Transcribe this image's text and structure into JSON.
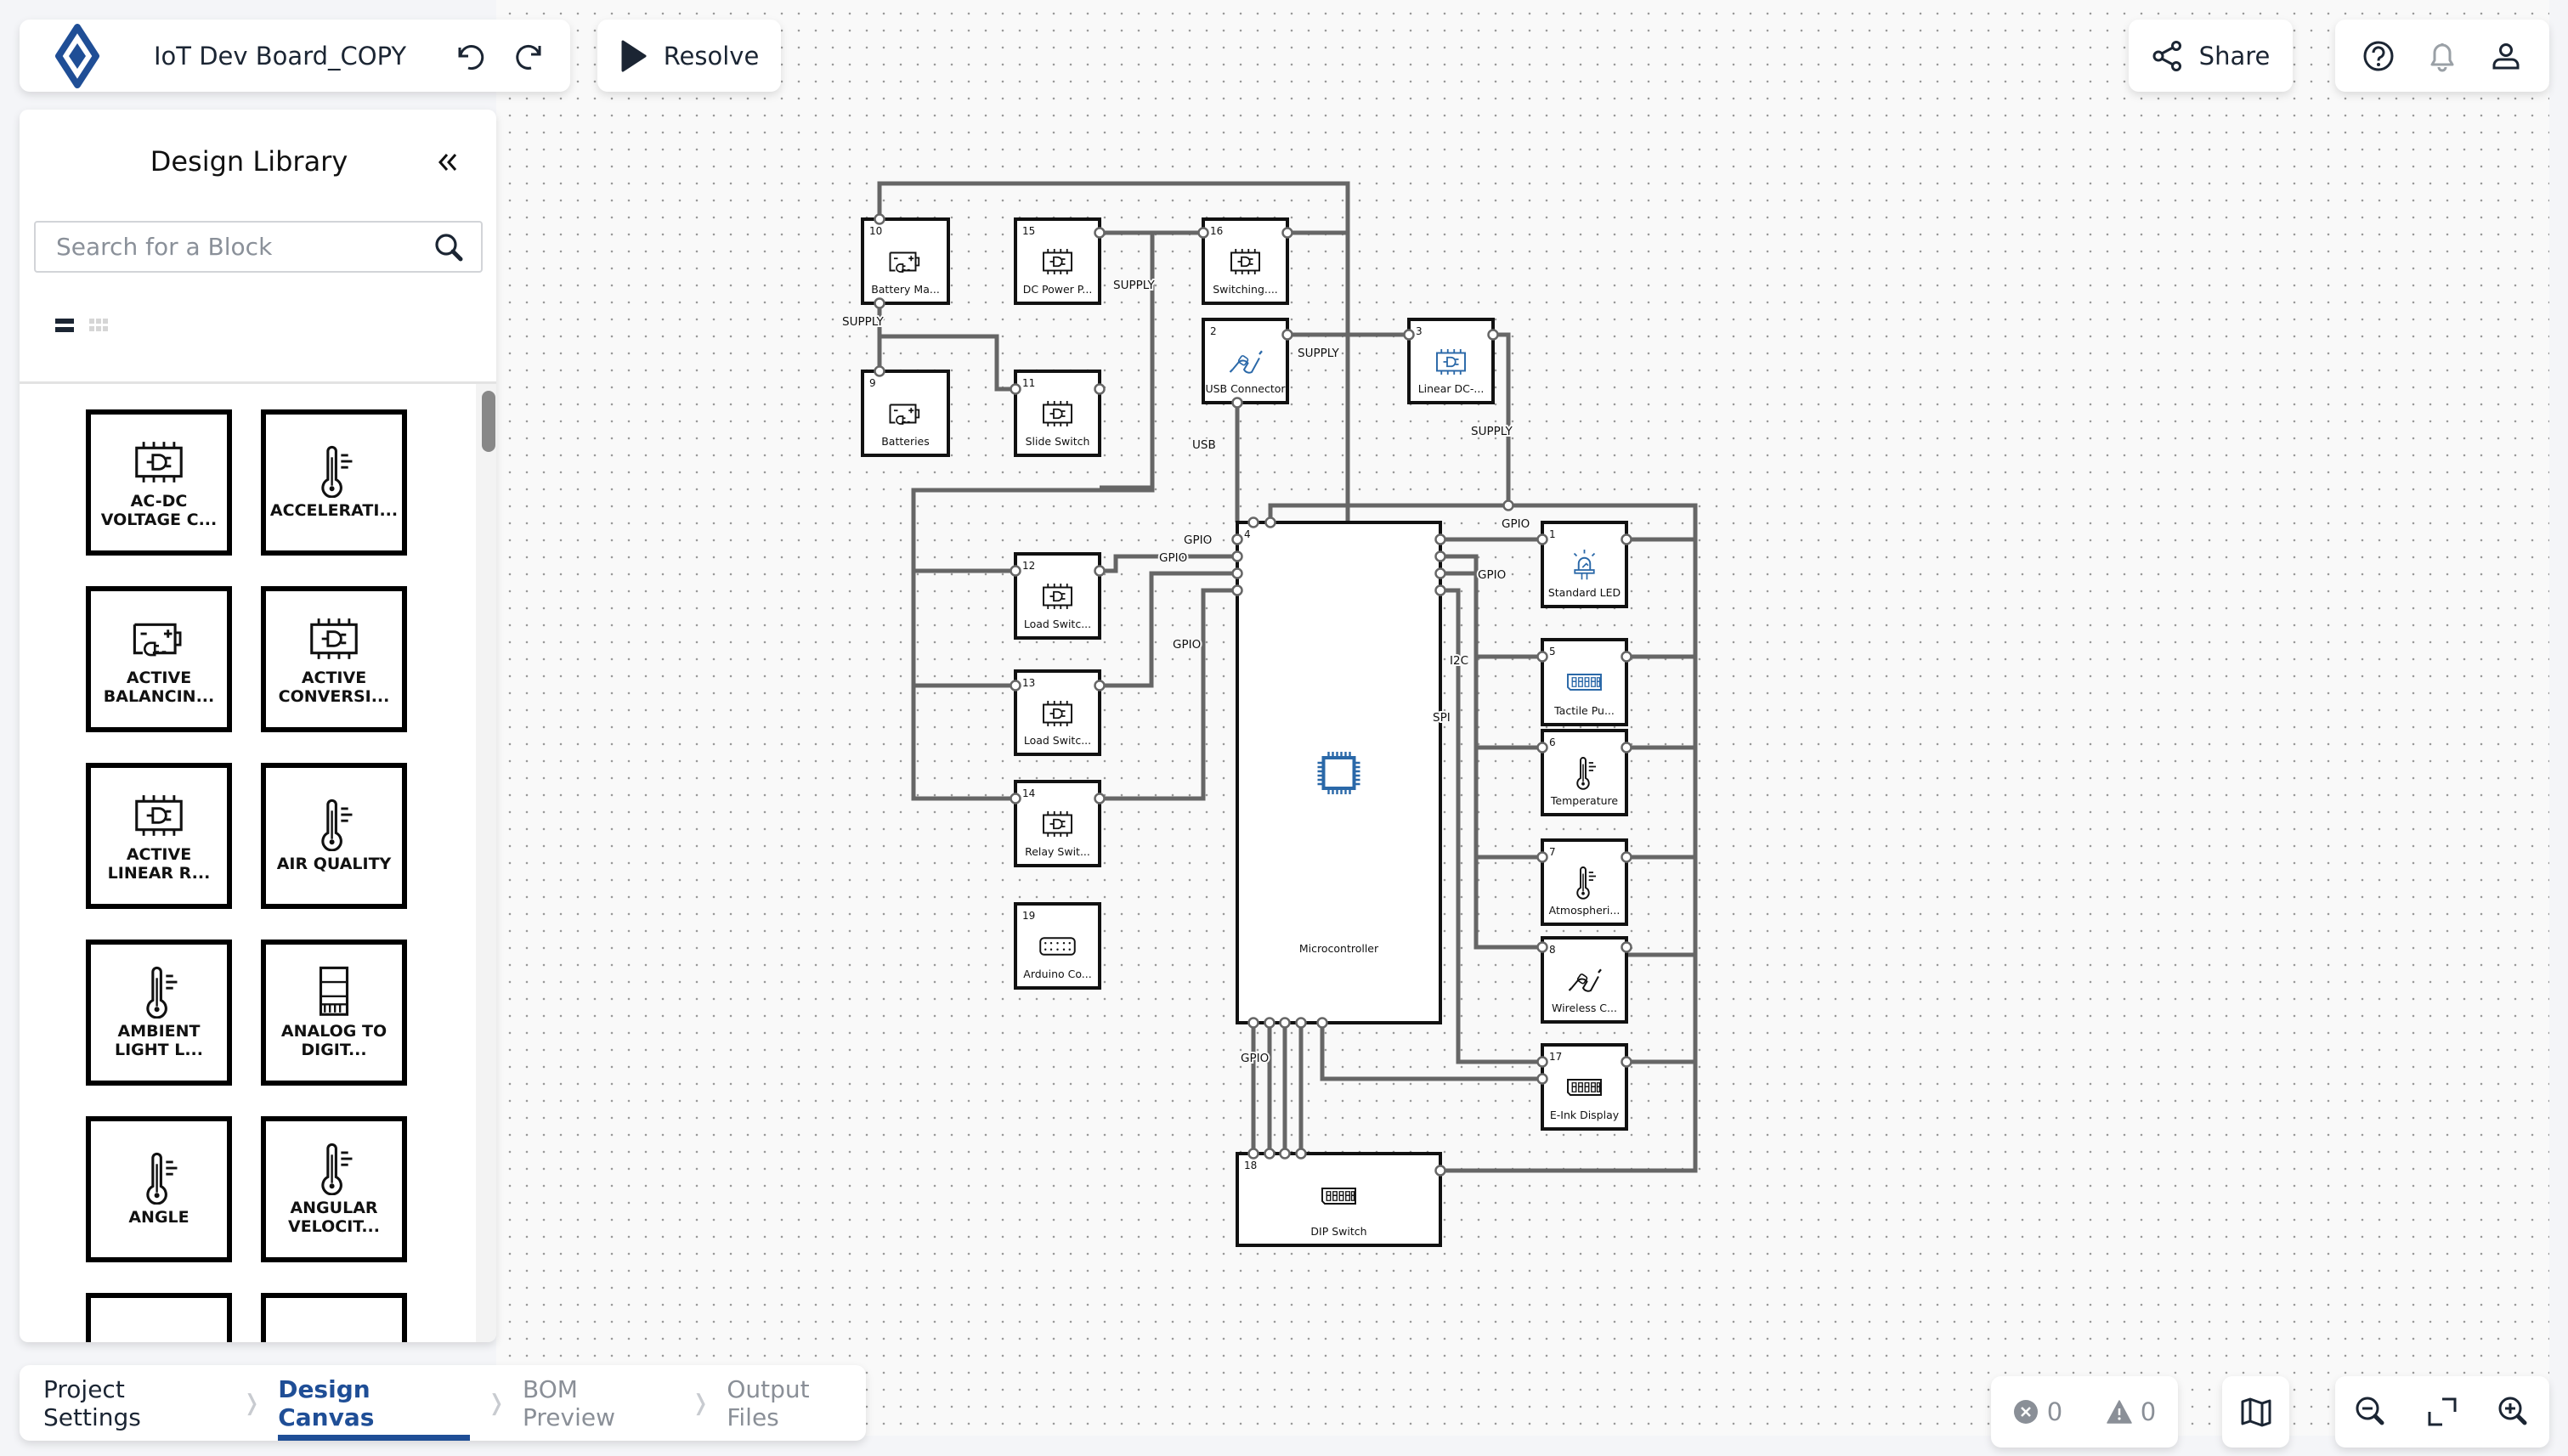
{
  "header": {
    "project_title": "IoT Dev Board_COPY",
    "undo_icon": "undo-icon",
    "redo_icon": "redo-icon",
    "resolve_label": "Resolve",
    "share_label": "Share",
    "help_icon": "help-circle-icon",
    "notifications_icon": "bell-icon",
    "account_icon": "user-icon",
    "brand_color": "#1f4e96"
  },
  "sidebar": {
    "title": "Design Library",
    "collapse_icon": "double-chevron-left-icon",
    "search_placeholder": "Search for a Block",
    "search_value": "",
    "view_modes": [
      "list",
      "grid"
    ],
    "active_view": "list",
    "library_items": [
      {
        "label": "AC-DC\nVOLTAGE C...",
        "icon": "ic-chip-plug-icon"
      },
      {
        "label": "ACCELERATI...",
        "icon": "thermometer-icon"
      },
      {
        "label": "ACTIVE\nBALANCIN...",
        "icon": "battery-plug-icon"
      },
      {
        "label": "ACTIVE\nCONVERSI...",
        "icon": "ic-chip-plug-icon"
      },
      {
        "label": "ACTIVE\nLINEAR R...",
        "icon": "ic-chip-plug-icon"
      },
      {
        "label": "AIR QUALITY",
        "icon": "thermometer-icon"
      },
      {
        "label": "AMBIENT\nLIGHT L...",
        "icon": "thermometer-icon"
      },
      {
        "label": "ANALOG TO\nDIGIT...",
        "icon": "module-icon"
      },
      {
        "label": "ANGLE",
        "icon": "thermometer-icon"
      },
      {
        "label": "ANGULAR\nVELOCIT...",
        "icon": "thermometer-icon"
      },
      {
        "label": "",
        "icon": ""
      },
      {
        "label": "",
        "icon": ""
      }
    ]
  },
  "schematic": {
    "blocks": [
      {
        "id": "10",
        "label": "Battery Ma...",
        "icon": "battery-plug-icon",
        "color": "#111111"
      },
      {
        "id": "15",
        "label": "DC Power P...",
        "icon": "ic-chip-plug-icon",
        "color": "#111111"
      },
      {
        "id": "16",
        "label": "Switching....",
        "icon": "ic-chip-plug-icon",
        "color": "#111111"
      },
      {
        "id": "9",
        "label": "Batteries",
        "icon": "battery-plug-icon",
        "color": "#111111"
      },
      {
        "id": "11",
        "label": "Slide Switch",
        "icon": "ic-chip-plug-icon",
        "color": "#111111"
      },
      {
        "id": "2",
        "label": "USB Connector",
        "icon": "cable-plug-icon",
        "color": "#2a68a8"
      },
      {
        "id": "3",
        "label": "Linear DC-...",
        "icon": "ic-chip-plug-icon",
        "color": "#2a68a8"
      },
      {
        "id": "12",
        "label": "Load Switc...",
        "icon": "ic-chip-plug-icon",
        "color": "#111111"
      },
      {
        "id": "13",
        "label": "Load Switc...",
        "icon": "ic-chip-plug-icon",
        "color": "#111111"
      },
      {
        "id": "14",
        "label": "Relay Swit...",
        "icon": "ic-chip-plug-icon",
        "color": "#111111"
      },
      {
        "id": "19",
        "label": "Arduino Co...",
        "icon": "header-connector-icon",
        "color": "#111111"
      },
      {
        "id": "4",
        "label": "Microcontroller",
        "icon": "microchip-icon",
        "color": "#2a68a8"
      },
      {
        "id": "1",
        "label": "Standard LED",
        "icon": "led-icon",
        "color": "#2a68a8"
      },
      {
        "id": "5",
        "label": "Tactile Pu...",
        "icon": "dip-switch-icon",
        "color": "#2a68a8"
      },
      {
        "id": "6",
        "label": "Temperature",
        "icon": "thermometer-icon",
        "color": "#111111"
      },
      {
        "id": "7",
        "label": "Atmospheri...",
        "icon": "thermometer-icon",
        "color": "#111111"
      },
      {
        "id": "8",
        "label": "Wireless C...",
        "icon": "cable-plug-icon",
        "color": "#111111"
      },
      {
        "id": "17",
        "label": "E-Ink Display",
        "icon": "dip-switch-icon",
        "color": "#111111"
      },
      {
        "id": "18",
        "label": "DIP Switch",
        "icon": "dip-switch-icon",
        "color": "#111111"
      }
    ],
    "net_labels": {
      "supply_a": "SUPPLY",
      "supply_b": "SUPPLY",
      "supply_c": "SUPPLY",
      "supply_d": "SUPPLY",
      "usb": "USB",
      "gpio_a": "GPIO",
      "gpio_b": "GPIO",
      "gpio_c": "GPIO",
      "gpio_d": "GPIO",
      "gpio_e": "GPIO",
      "gpio_f": "GPIO",
      "i2c": "I2C",
      "spi": "SPI"
    }
  },
  "footer": {
    "steps": [
      {
        "label": "Project Settings",
        "state": "done"
      },
      {
        "label": "Design Canvas",
        "state": "active"
      },
      {
        "label": "BOM Preview",
        "state": "future"
      },
      {
        "label": "Output Files",
        "state": "future"
      }
    ],
    "error_count": "0",
    "warning_count": "0",
    "map_icon": "map-icon",
    "zoom_out_icon": "zoom-out-icon",
    "fit_icon": "fit-screen-icon",
    "zoom_in_icon": "zoom-in-icon"
  }
}
